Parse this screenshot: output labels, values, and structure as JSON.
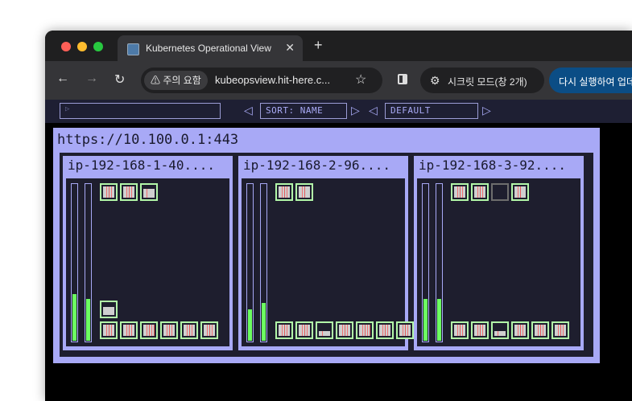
{
  "browser": {
    "tab_title": "Kubernetes Operational View",
    "tab_close": "✕",
    "new_tab": "+",
    "back": "←",
    "forward": "→",
    "reload": "↻",
    "security_warning": "⚠ 주의 요함",
    "url": "kubeopsview.hit-here.c...",
    "bookmark_star": "☆",
    "incognito_label": "시크릿 모드(창 2개)",
    "relaunch_label": "다시 실행하여 업데이트",
    "colors": {
      "close": "#ff5f57",
      "minimize": "#febc2e",
      "zoom": "#28c840",
      "relaunch": "#0b4d85"
    }
  },
  "kube": {
    "filter_placeholder": "▷",
    "sort_label": "SORT: NAME",
    "theme_label": "DEFAULT",
    "arrow_left": "◁",
    "arrow_right": "▷",
    "colors": {
      "panel": "#a8a9f6",
      "bg": "#1e1e2e",
      "pod_border": "#b2f7a8",
      "gauge": "#6cff61"
    },
    "cluster": {
      "title": "https://10.100.0.1:443",
      "nodes": [
        {
          "name": "ip-192-168-1-40....",
          "cpu_gauge": 0.3,
          "mem_gauge": 0.27,
          "pods_top": [
            {
              "status": "running",
              "level": 1.0,
              "bars": 3
            },
            {
              "status": "running",
              "level": 1.0,
              "bars": 3
            },
            {
              "status": "running",
              "level": 0.8,
              "bars": 1
            }
          ],
          "pods_mid": [
            {
              "status": "running",
              "level": 0.7,
              "bars": 0
            }
          ],
          "pods_bottom": [
            {
              "status": "running",
              "level": 1.0,
              "bars": 3
            },
            {
              "status": "running",
              "level": 1.0,
              "bars": 3
            },
            {
              "status": "running",
              "level": 1.0,
              "bars": 5
            },
            {
              "status": "running",
              "level": 1.0,
              "bars": 3
            },
            {
              "status": "running",
              "level": 1.0,
              "bars": 3
            },
            {
              "status": "running",
              "level": 1.0,
              "bars": 3
            }
          ]
        },
        {
          "name": "ip-192-168-2-96....",
          "cpu_gauge": 0.2,
          "mem_gauge": 0.24,
          "pods_top": [
            {
              "status": "running",
              "level": 1.0,
              "bars": 3
            },
            {
              "status": "running",
              "level": 1.0,
              "bars": 2
            }
          ],
          "pods_mid": [],
          "pods_bottom": [
            {
              "status": "running",
              "level": 1.0,
              "bars": 3
            },
            {
              "status": "running",
              "level": 1.0,
              "bars": 3
            },
            {
              "status": "running",
              "level": 0.4,
              "bars": 1
            },
            {
              "status": "running",
              "level": 1.0,
              "bars": 3
            },
            {
              "status": "running",
              "level": 1.0,
              "bars": 5
            },
            {
              "status": "running",
              "level": 1.0,
              "bars": 3
            },
            {
              "status": "running",
              "level": 1.0,
              "bars": 3
            }
          ]
        },
        {
          "name": "ip-192-168-3-92....",
          "cpu_gauge": 0.27,
          "mem_gauge": 0.27,
          "pods_top": [
            {
              "status": "running",
              "level": 1.0,
              "bars": 3
            },
            {
              "status": "running",
              "level": 1.0,
              "bars": 3
            },
            {
              "status": "pending",
              "level": 0.0,
              "bars": 0
            },
            {
              "status": "running",
              "level": 1.0,
              "bars": 2
            }
          ],
          "pods_mid": [],
          "pods_bottom": [
            {
              "status": "running",
              "level": 1.0,
              "bars": 3
            },
            {
              "status": "running",
              "level": 1.0,
              "bars": 3
            },
            {
              "status": "running",
              "level": 0.4,
              "bars": 1
            },
            {
              "status": "running",
              "level": 1.0,
              "bars": 3
            },
            {
              "status": "running",
              "level": 1.0,
              "bars": 3
            },
            {
              "status": "running",
              "level": 1.0,
              "bars": 3
            }
          ]
        }
      ]
    }
  }
}
